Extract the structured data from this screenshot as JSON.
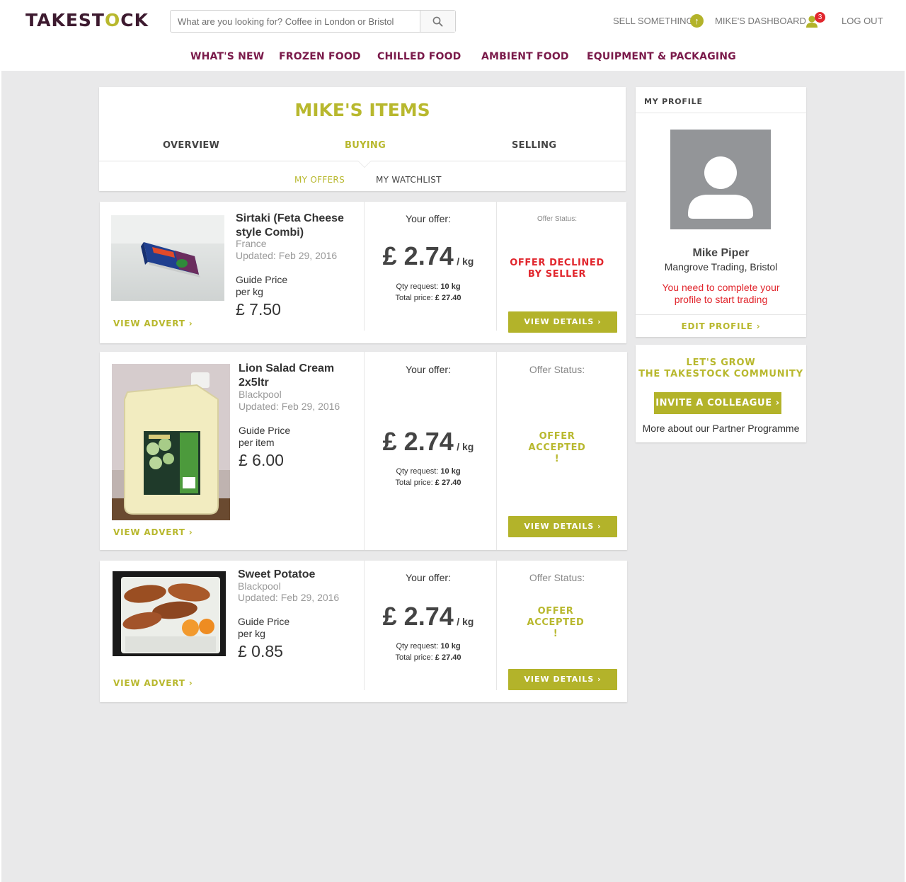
{
  "header": {
    "logo_pre": "TAKEST",
    "logo_o": "O",
    "logo_post": "CK",
    "search_placeholder": "What are you looking for? Coffee in London or Bristol",
    "sell_label": "SELL SOMETHING",
    "sell_icon_glyph": "↑",
    "dashboard_label": "MIKE'S DASHBOARD",
    "notification_count": "3",
    "logout_label": "LOG OUT"
  },
  "nav": {
    "items": [
      "WHAT'S NEW",
      "FROZEN FOOD",
      "CHILLED FOOD",
      "AMBIENT FOOD",
      "EQUIPMENT & PACKAGING"
    ]
  },
  "items_panel": {
    "title": "MIKE'S ITEMS",
    "tabs": [
      "OVERVIEW",
      "BUYING",
      "SELLING"
    ],
    "subtabs": [
      "MY OFFERS",
      "MY WATCHLIST"
    ]
  },
  "offers": [
    {
      "name": "Sirtaki (Feta Cheese style Combi)",
      "location": "France",
      "updated": "Updated: Feb 29, 2016",
      "guide_label": "Guide Price",
      "guide_unit": "per kg",
      "guide_price": "£ 7.50",
      "view_advert": "VIEW ADVERT ›",
      "your_offer_label": "Your offer:",
      "offer_price": "£ 2.74",
      "offer_unit": "/ kg",
      "qty_label": "Qty request:",
      "qty_value": "10 kg",
      "total_label": "Total price:",
      "total_value": "£ 27.40",
      "status_label": "Offer Status:",
      "status_line1": "OFFER DECLINED",
      "status_line2": "BY SELLER",
      "status_line3": "",
      "status_color": "#e1262d",
      "details_label": "VIEW DETAILS ›"
    },
    {
      "name": "Lion Salad Cream 2x5ltr",
      "location": "Blackpool",
      "updated": "Updated: Feb 29, 2016",
      "guide_label": "Guide Price",
      "guide_unit": "per item",
      "guide_price": "£ 6.00",
      "view_advert": "VIEW ADVERT ›",
      "your_offer_label": "Your offer:",
      "offer_price": "£ 2.74",
      "offer_unit": "/ kg",
      "qty_label": "Qty request:",
      "qty_value": "10 kg",
      "total_label": "Total price:",
      "total_value": "£ 27.40",
      "status_label": "Offer Status:",
      "status_line1": "OFFER",
      "status_line2": "ACCEPTED",
      "status_line3": "!",
      "status_color": "#b8b82e",
      "details_label": "VIEW DETAILS ›"
    },
    {
      "name": "Sweet Potatoe",
      "location": "Blackpool",
      "updated": "Updated: Feb 29, 2016",
      "guide_label": "Guide Price",
      "guide_unit": "per kg",
      "guide_price": "£ 0.85",
      "view_advert": "VIEW ADVERT ›",
      "your_offer_label": "Your offer:",
      "offer_price": "£ 2.74",
      "offer_unit": "/ kg",
      "qty_label": "Qty request:",
      "qty_value": "10 kg",
      "total_label": "Total price:",
      "total_value": "£ 27.40",
      "status_label": "Offer Status:",
      "status_line1": "OFFER",
      "status_line2": "ACCEPTED",
      "status_line3": "!",
      "status_color": "#b8b82e",
      "details_label": "VIEW DETAILS ›"
    }
  ],
  "profile": {
    "heading": "MY PROFILE",
    "name": "Mike Piper",
    "company": "Mangrove Trading, Bristol",
    "warning_line1": "You need to complete your",
    "warning_line2": "profile to start trading",
    "edit_label": "EDIT PROFILE ›"
  },
  "community": {
    "line1": "LET'S GROW",
    "line2": "THE TAKESTOCK COMMUNITY",
    "invite_label": "INVITE A COLLEAGUE ›",
    "partner_link": "More about our Partner Programme"
  },
  "colors": {
    "brand_dark": "#3d1a2f",
    "accent": "#b8b82e",
    "nav": "#7a1a4a",
    "declined": "#e1262d"
  }
}
